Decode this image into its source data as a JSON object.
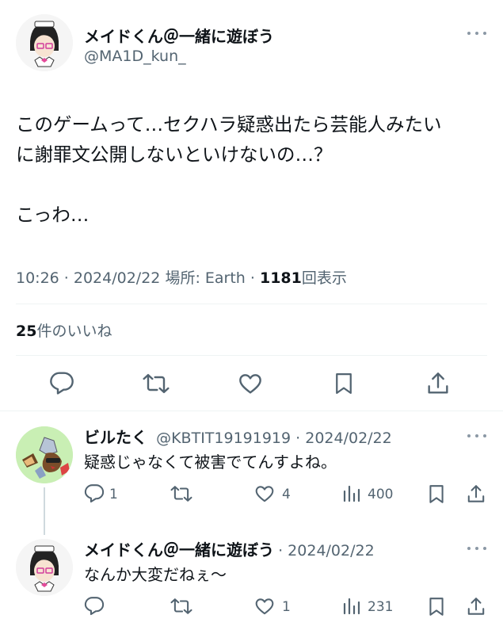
{
  "main_tweet": {
    "display_name": "メイドくん＠一緒に遊ぼう",
    "handle": "@MA1D_kun_",
    "text_line1": "このゲームって…セクハラ疑惑出たら芸能人みたい",
    "text_line2": "に謝罪文公開しないといけないの…？",
    "text_line3": "こっわ…",
    "time": "10:26 · 2024/02/22",
    "location": "場所: Earth ·",
    "views_count": "1181",
    "views_label": "回表示",
    "likes_count": "25",
    "likes_label": "件のいいね"
  },
  "replies": [
    {
      "display_name": "ビルたく",
      "handle_date": "@KBTIT19191919 · 2024/02/22",
      "text": "疑惑じゃなくて被害でてんすよね。",
      "reply_count": "1",
      "like_count": "4",
      "view_count": "400"
    },
    {
      "display_name": "メイドくん＠一緒に遊ぼう",
      "handle_date": "· 2024/02/22",
      "text": "なんか大変だねぇ〜",
      "reply_count": "",
      "like_count": "1",
      "view_count": "231"
    }
  ],
  "colors": {
    "text": "#0f1419",
    "secondary": "#536471",
    "divider": "#eff3f4"
  }
}
